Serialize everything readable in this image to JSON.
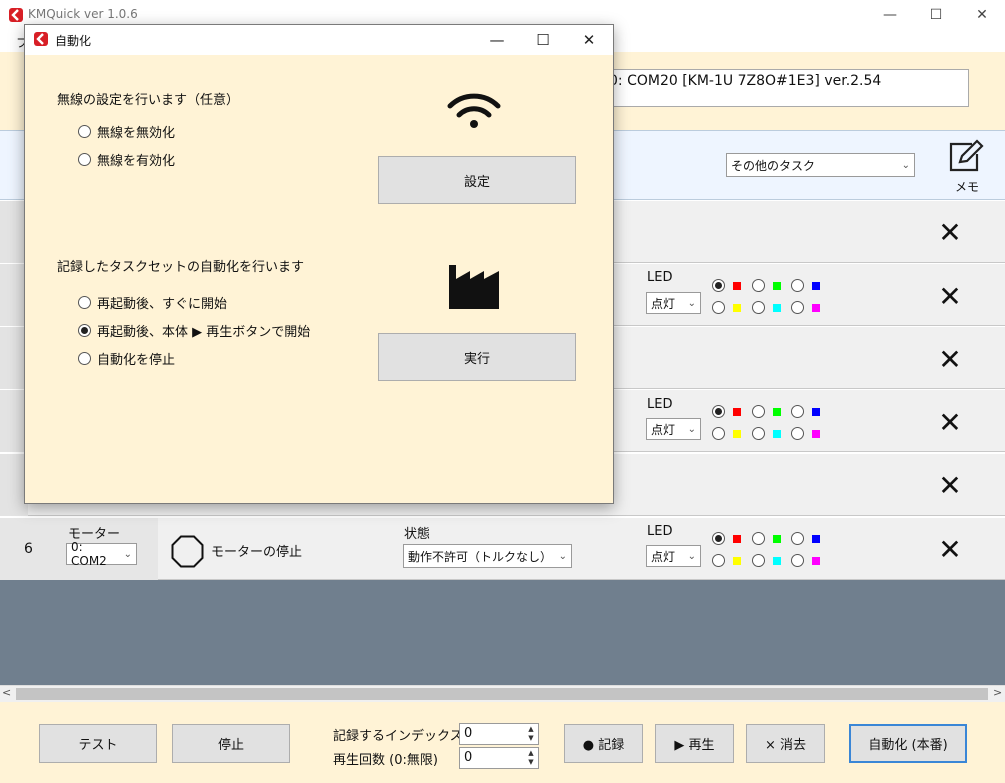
{
  "app": {
    "title": "KMQuick ver 1.0.6",
    "menu_first": "フ",
    "device": "0: COM20 [KM-1U 7Z8O#1E3] ver.2.54",
    "window_controls": [
      "—",
      "☐",
      "✕"
    ]
  },
  "header": {
    "task_category": "その他のタスク",
    "memo_label": "メモ",
    "memo_icon": "edit-icon"
  },
  "led": {
    "label": "LED",
    "mode": "点灯",
    "colors": [
      "#ff0000",
      "#00ff00",
      "#0000ff",
      "#ffff00",
      "#00ffff",
      "#ff00ff"
    ]
  },
  "row6": {
    "number": "6",
    "motor_label": "モーター",
    "motor_value": "0: COM2",
    "action": "モーターの停止",
    "action_icon": "octagon-stop-icon",
    "state_label": "状態",
    "state_value": "動作不許可（トルクなし）"
  },
  "delete_symbol": "✕",
  "bottom": {
    "test": "テスト",
    "stop": "停止",
    "record_index_label": "記録するインデックス",
    "record_index_value": "0",
    "play_count_label": "再生回数 (0:無限)",
    "play_count_value": "0",
    "record": "● 記録",
    "play": "▶ 再生",
    "erase": "× 消去",
    "automation": "自動化 (本番)"
  },
  "dialog": {
    "title": "自動化",
    "wireless_heading": "無線の設定を行います（任意）",
    "wireless_options": [
      "無線を無効化",
      "無線を有効化"
    ],
    "settings_button": "設定",
    "automation_heading": "記録したタスクセットの自動化を行います",
    "automation_options": [
      "再起動後、すぐに開始",
      "再起動後、本体 ▶ 再生ボタンで開始",
      "自動化を停止"
    ],
    "automation_selected_index": 1,
    "execute_button": "実行",
    "wifi_icon": "wifi-icon",
    "factory_icon": "factory-icon"
  }
}
